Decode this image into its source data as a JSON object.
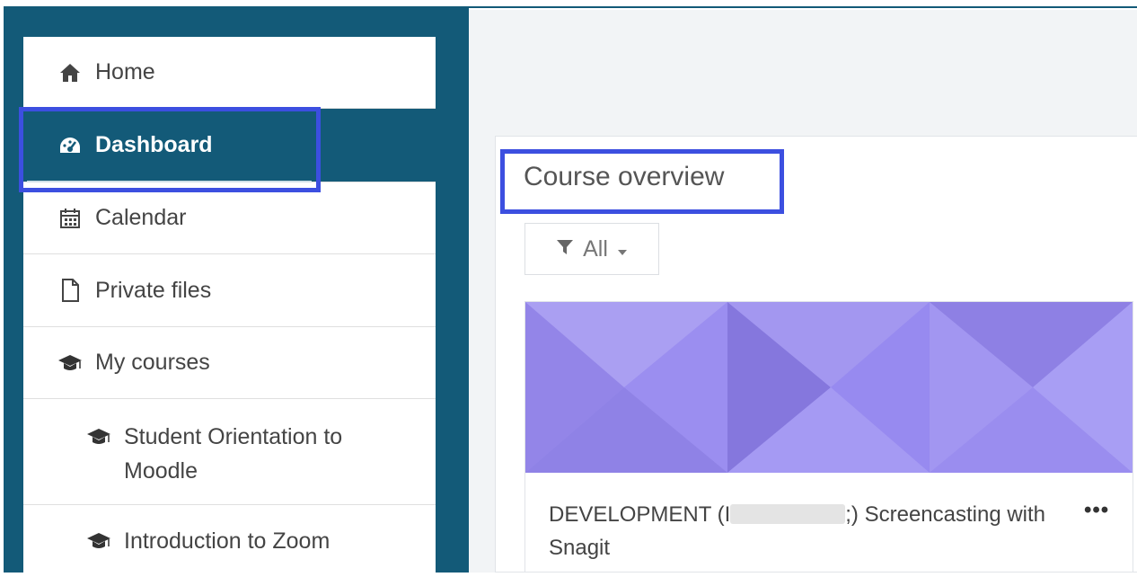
{
  "nav": {
    "items": [
      {
        "label": "Home",
        "icon": "home-icon"
      },
      {
        "label": "Dashboard",
        "icon": "tachometer-icon",
        "active": true
      },
      {
        "label": "Calendar",
        "icon": "calendar-icon"
      },
      {
        "label": "Private files",
        "icon": "file-icon"
      },
      {
        "label": "My courses",
        "icon": "graduation-cap-icon"
      },
      {
        "label": "Student Orientation to Moodle",
        "icon": "graduation-cap-icon",
        "sub": true
      },
      {
        "label": "Introduction to Zoom",
        "icon": "graduation-cap-icon",
        "sub": true
      }
    ]
  },
  "course_overview": {
    "title": "Course overview",
    "filter_label": "All",
    "course": {
      "name_prefix": "DEVELOPMENT (I",
      "name_suffix": ";) Screencasting with Snagit",
      "more_label": "•••"
    }
  },
  "colors": {
    "nav_bg": "#135a78",
    "highlight": "#3c4fe0",
    "course_image": "#9f92ee"
  }
}
